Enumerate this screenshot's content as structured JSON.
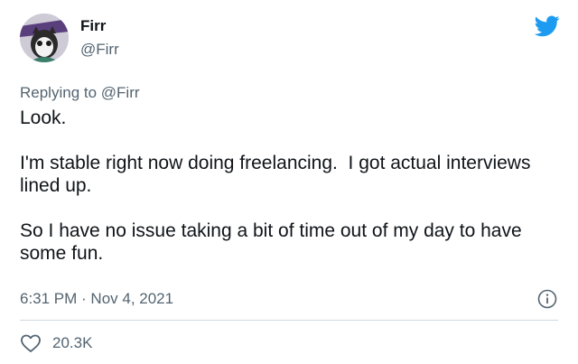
{
  "tweet": {
    "author_name": "Firr",
    "author_handle": "@Firr",
    "replying_to": "Replying to @Firr",
    "paragraphs": [
      "Look.",
      "I'm stable right now doing freelancing.  I got actual interviews lined up.",
      "So I have no issue taking a bit of time out of my day to have some fun."
    ],
    "timestamp": "6:31 PM · Nov 4, 2021",
    "like_count": "20.3K"
  },
  "icons": {
    "brand": "twitter-bird-icon",
    "info": "info-icon",
    "like": "heart-icon"
  },
  "colors": {
    "brand": "#1d9bf0",
    "secondary_text": "#536471",
    "divider": "#cfd9de"
  }
}
